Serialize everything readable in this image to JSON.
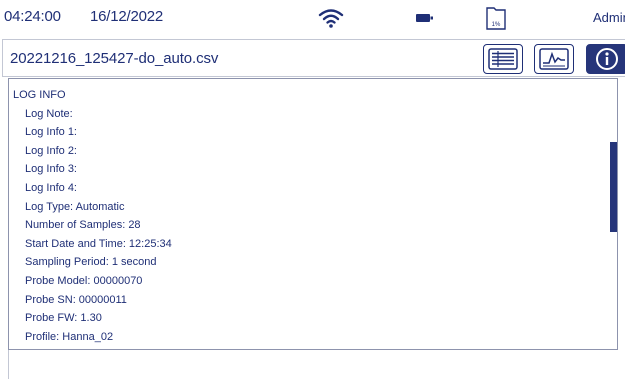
{
  "status": {
    "time": "04:24:00",
    "date": "16/12/2022",
    "storage_percent": "1%",
    "user": "Admin"
  },
  "file": {
    "name": "20221216_125427-do_auto.csv"
  },
  "log": {
    "title": "LOG INFO",
    "rows": [
      "Log Note:",
      "Log Info 1:",
      "Log Info 2:",
      "Log Info 3:",
      "Log Info 4:",
      "Log Type: Automatic",
      "Number of Samples: 28",
      "Start Date and Time: 12:25:34",
      "Sampling Period: 1 second",
      "Probe Model: 00000070",
      "Probe SN: 00000011",
      "Probe FW: 1.30",
      "Profile: Hanna_02"
    ]
  },
  "icons": {
    "wifi": "wifi-icon",
    "battery": "battery-icon",
    "storage": "storage-icon",
    "table_view": "list-view-icon",
    "graph_view": "graph-icon",
    "info": "info-icon"
  },
  "colors": {
    "primary": "#1f2f76",
    "accent_fill": "#26357a",
    "border": "#8d93ad"
  }
}
